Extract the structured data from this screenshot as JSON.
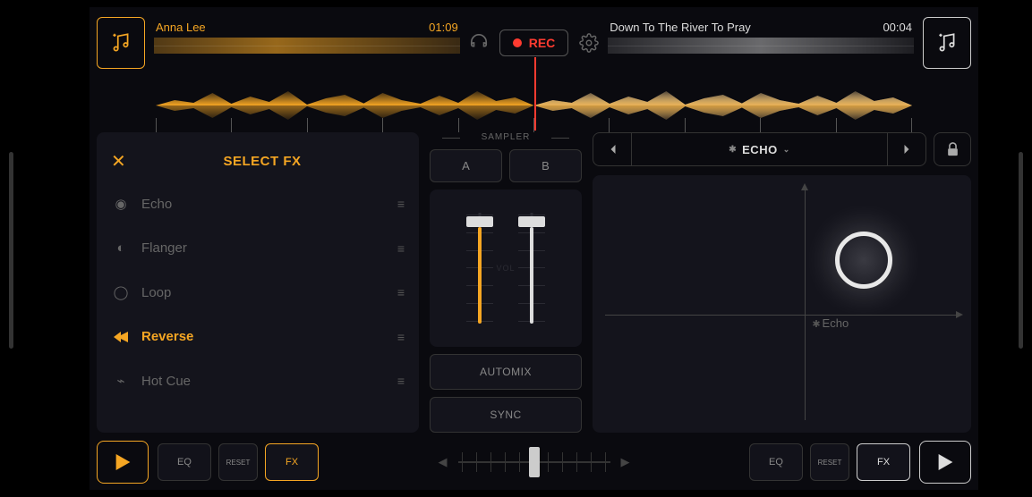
{
  "header": {
    "deck_a": {
      "title": "Anna Lee",
      "time": "01:09"
    },
    "deck_b": {
      "title": "Down To The River To Pray",
      "time": "00:04"
    },
    "rec_label": "REC"
  },
  "fx_panel": {
    "title": "SELECT FX",
    "items": [
      {
        "label": "Echo",
        "active": false
      },
      {
        "label": "Flanger",
        "active": false
      },
      {
        "label": "Loop",
        "active": false
      },
      {
        "label": "Reverse",
        "active": true
      },
      {
        "label": "Hot Cue",
        "active": false
      }
    ]
  },
  "sampler": {
    "label": "SAMPLER",
    "a": "A",
    "b": "B",
    "vol_label": "VOL",
    "automix": "AUTOMIX",
    "sync": "SYNC"
  },
  "xy": {
    "fx_name": "ECHO",
    "axis_label": "Echo"
  },
  "bottom": {
    "eq": "EQ",
    "reset": "RESET",
    "fx": "FX"
  }
}
